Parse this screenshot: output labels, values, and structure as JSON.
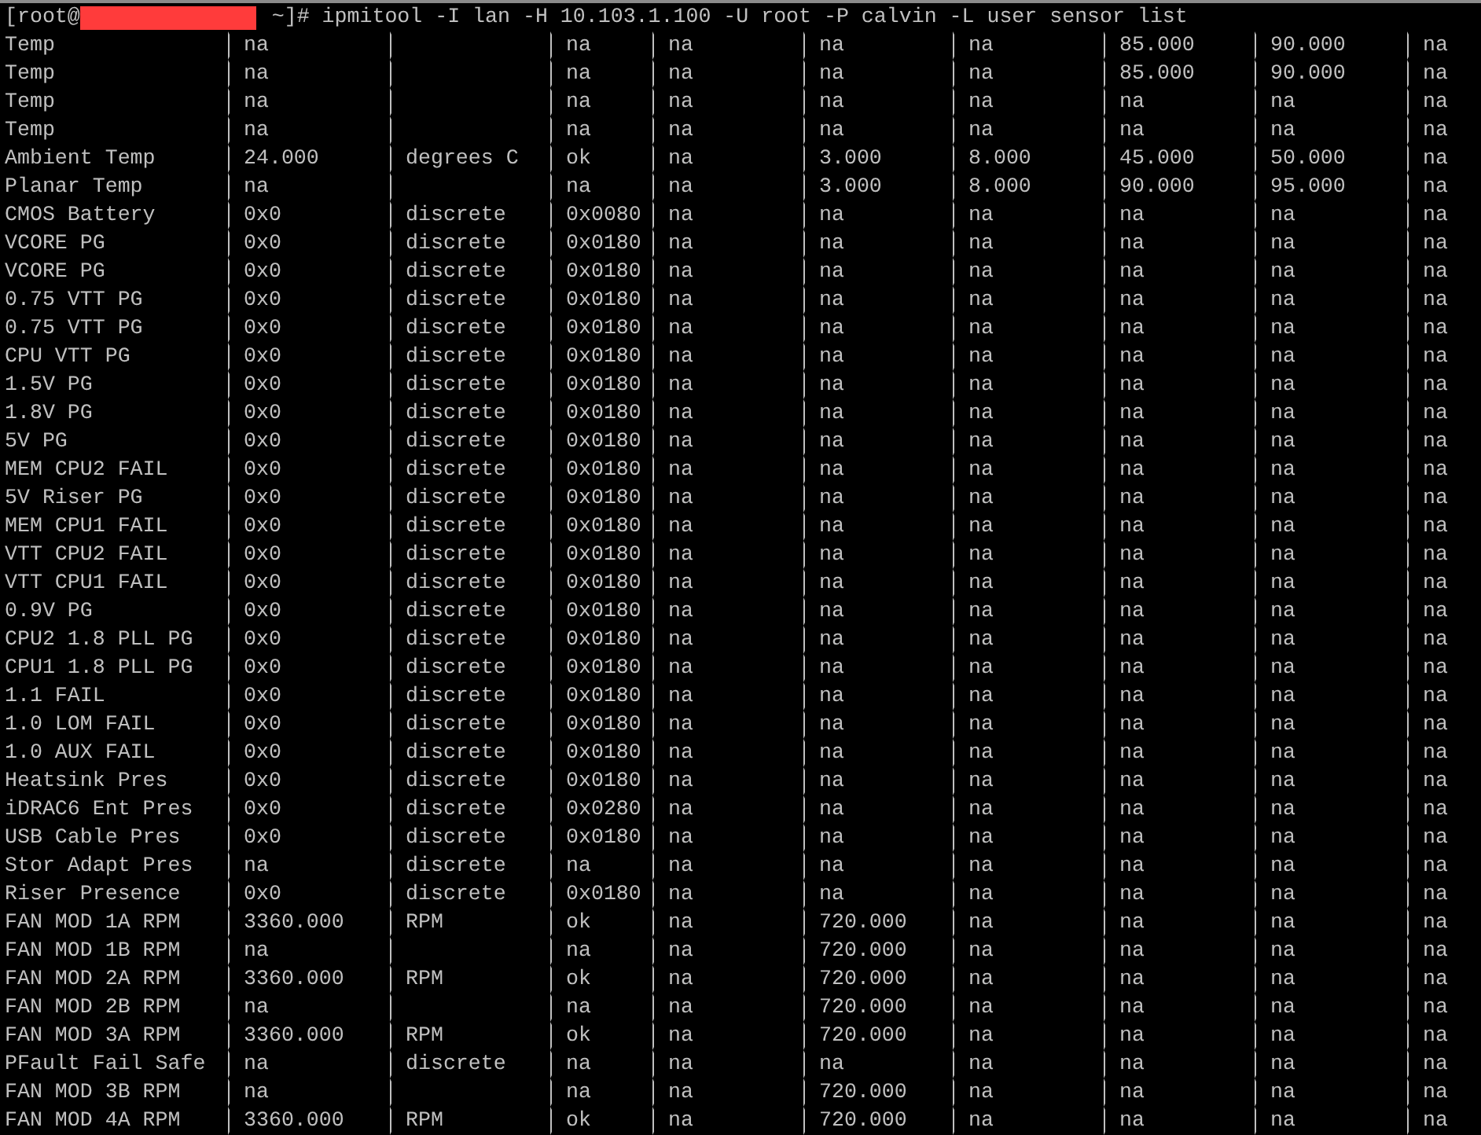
{
  "terminal": {
    "prompt_start": "[root@",
    "redacted": true,
    "command": "~]# ipmitool -I lan -H 10.103.1.100 -U root -P calvin -L user sensor list",
    "rows": [
      [
        "Temp",
        "na",
        null,
        "na",
        "na",
        "na",
        "na",
        "85.000",
        "90.000",
        "na"
      ],
      [
        "Temp",
        "na",
        null,
        "na",
        "na",
        "na",
        "na",
        "85.000",
        "90.000",
        "na"
      ],
      [
        "Temp",
        "na",
        null,
        "na",
        "na",
        "na",
        "na",
        "na",
        "na",
        "na"
      ],
      [
        "Temp",
        "na",
        null,
        "na",
        "na",
        "na",
        "na",
        "na",
        "na",
        "na"
      ],
      [
        "Ambient Temp",
        "24.000",
        "degrees C",
        "ok",
        "na",
        "3.000",
        "8.000",
        "45.000",
        "50.000",
        "na"
      ],
      [
        "Planar Temp",
        "na",
        null,
        "na",
        "na",
        "3.000",
        "8.000",
        "90.000",
        "95.000",
        "na"
      ],
      [
        "CMOS Battery",
        "0x0",
        "discrete",
        "0x0080",
        "na",
        "na",
        "na",
        "na",
        "na",
        "na"
      ],
      [
        "VCORE PG",
        "0x0",
        "discrete",
        "0x0180",
        "na",
        "na",
        "na",
        "na",
        "na",
        "na"
      ],
      [
        "VCORE PG",
        "0x0",
        "discrete",
        "0x0180",
        "na",
        "na",
        "na",
        "na",
        "na",
        "na"
      ],
      [
        "0.75 VTT PG",
        "0x0",
        "discrete",
        "0x0180",
        "na",
        "na",
        "na",
        "na",
        "na",
        "na"
      ],
      [
        "0.75 VTT PG",
        "0x0",
        "discrete",
        "0x0180",
        "na",
        "na",
        "na",
        "na",
        "na",
        "na"
      ],
      [
        "CPU VTT PG",
        "0x0",
        "discrete",
        "0x0180",
        "na",
        "na",
        "na",
        "na",
        "na",
        "na"
      ],
      [
        "1.5V PG",
        "0x0",
        "discrete",
        "0x0180",
        "na",
        "na",
        "na",
        "na",
        "na",
        "na"
      ],
      [
        "1.8V PG",
        "0x0",
        "discrete",
        "0x0180",
        "na",
        "na",
        "na",
        "na",
        "na",
        "na"
      ],
      [
        "5V PG",
        "0x0",
        "discrete",
        "0x0180",
        "na",
        "na",
        "na",
        "na",
        "na",
        "na"
      ],
      [
        "MEM CPU2 FAIL",
        "0x0",
        "discrete",
        "0x0180",
        "na",
        "na",
        "na",
        "na",
        "na",
        "na"
      ],
      [
        "5V Riser PG",
        "0x0",
        "discrete",
        "0x0180",
        "na",
        "na",
        "na",
        "na",
        "na",
        "na"
      ],
      [
        "MEM CPU1 FAIL",
        "0x0",
        "discrete",
        "0x0180",
        "na",
        "na",
        "na",
        "na",
        "na",
        "na"
      ],
      [
        "VTT CPU2 FAIL",
        "0x0",
        "discrete",
        "0x0180",
        "na",
        "na",
        "na",
        "na",
        "na",
        "na"
      ],
      [
        "VTT CPU1 FAIL",
        "0x0",
        "discrete",
        "0x0180",
        "na",
        "na",
        "na",
        "na",
        "na",
        "na"
      ],
      [
        "0.9V PG",
        "0x0",
        "discrete",
        "0x0180",
        "na",
        "na",
        "na",
        "na",
        "na",
        "na"
      ],
      [
        "CPU2 1.8 PLL PG",
        "0x0",
        "discrete",
        "0x0180",
        "na",
        "na",
        "na",
        "na",
        "na",
        "na"
      ],
      [
        "CPU1 1.8 PLL PG",
        "0x0",
        "discrete",
        "0x0180",
        "na",
        "na",
        "na",
        "na",
        "na",
        "na"
      ],
      [
        "1.1 FAIL",
        "0x0",
        "discrete",
        "0x0180",
        "na",
        "na",
        "na",
        "na",
        "na",
        "na"
      ],
      [
        "1.0 LOM FAIL",
        "0x0",
        "discrete",
        "0x0180",
        "na",
        "na",
        "na",
        "na",
        "na",
        "na"
      ],
      [
        "1.0 AUX FAIL",
        "0x0",
        "discrete",
        "0x0180",
        "na",
        "na",
        "na",
        "na",
        "na",
        "na"
      ],
      [
        "Heatsink Pres",
        "0x0",
        "discrete",
        "0x0180",
        "na",
        "na",
        "na",
        "na",
        "na",
        "na"
      ],
      [
        "iDRAC6 Ent Pres",
        "0x0",
        "discrete",
        "0x0280",
        "na",
        "na",
        "na",
        "na",
        "na",
        "na"
      ],
      [
        "USB Cable Pres",
        "0x0",
        "discrete",
        "0x0180",
        "na",
        "na",
        "na",
        "na",
        "na",
        "na"
      ],
      [
        "Stor Adapt Pres",
        "na",
        "discrete",
        "na",
        "na",
        "na",
        "na",
        "na",
        "na",
        "na"
      ],
      [
        "Riser Presence",
        "0x0",
        "discrete",
        "0x0180",
        "na",
        "na",
        "na",
        "na",
        "na",
        "na"
      ],
      [
        "FAN MOD 1A RPM",
        "3360.000",
        "RPM",
        "ok",
        "na",
        "720.000",
        "na",
        "na",
        "na",
        "na"
      ],
      [
        "FAN MOD 1B RPM",
        "na",
        null,
        "na",
        "na",
        "720.000",
        "na",
        "na",
        "na",
        "na"
      ],
      [
        "FAN MOD 2A RPM",
        "3360.000",
        "RPM",
        "ok",
        "na",
        "720.000",
        "na",
        "na",
        "na",
        "na"
      ],
      [
        "FAN MOD 2B RPM",
        "na",
        null,
        "na",
        "na",
        "720.000",
        "na",
        "na",
        "na",
        "na"
      ],
      [
        "FAN MOD 3A RPM",
        "3360.000",
        "RPM",
        "ok",
        "na",
        "720.000",
        "na",
        "na",
        "na",
        "na"
      ],
      [
        "PFault Fail Safe",
        "na",
        "discrete",
        "na",
        "na",
        "na",
        "na",
        "na",
        "na",
        "na"
      ],
      [
        "FAN MOD 3B RPM",
        "na",
        null,
        "na",
        "na",
        "720.000",
        "na",
        "na",
        "na",
        "na"
      ],
      [
        "FAN MOD 4A RPM",
        "3360.000",
        "RPM",
        "ok",
        "na",
        "720.000",
        "na",
        "na",
        "na",
        "na"
      ]
    ]
  }
}
